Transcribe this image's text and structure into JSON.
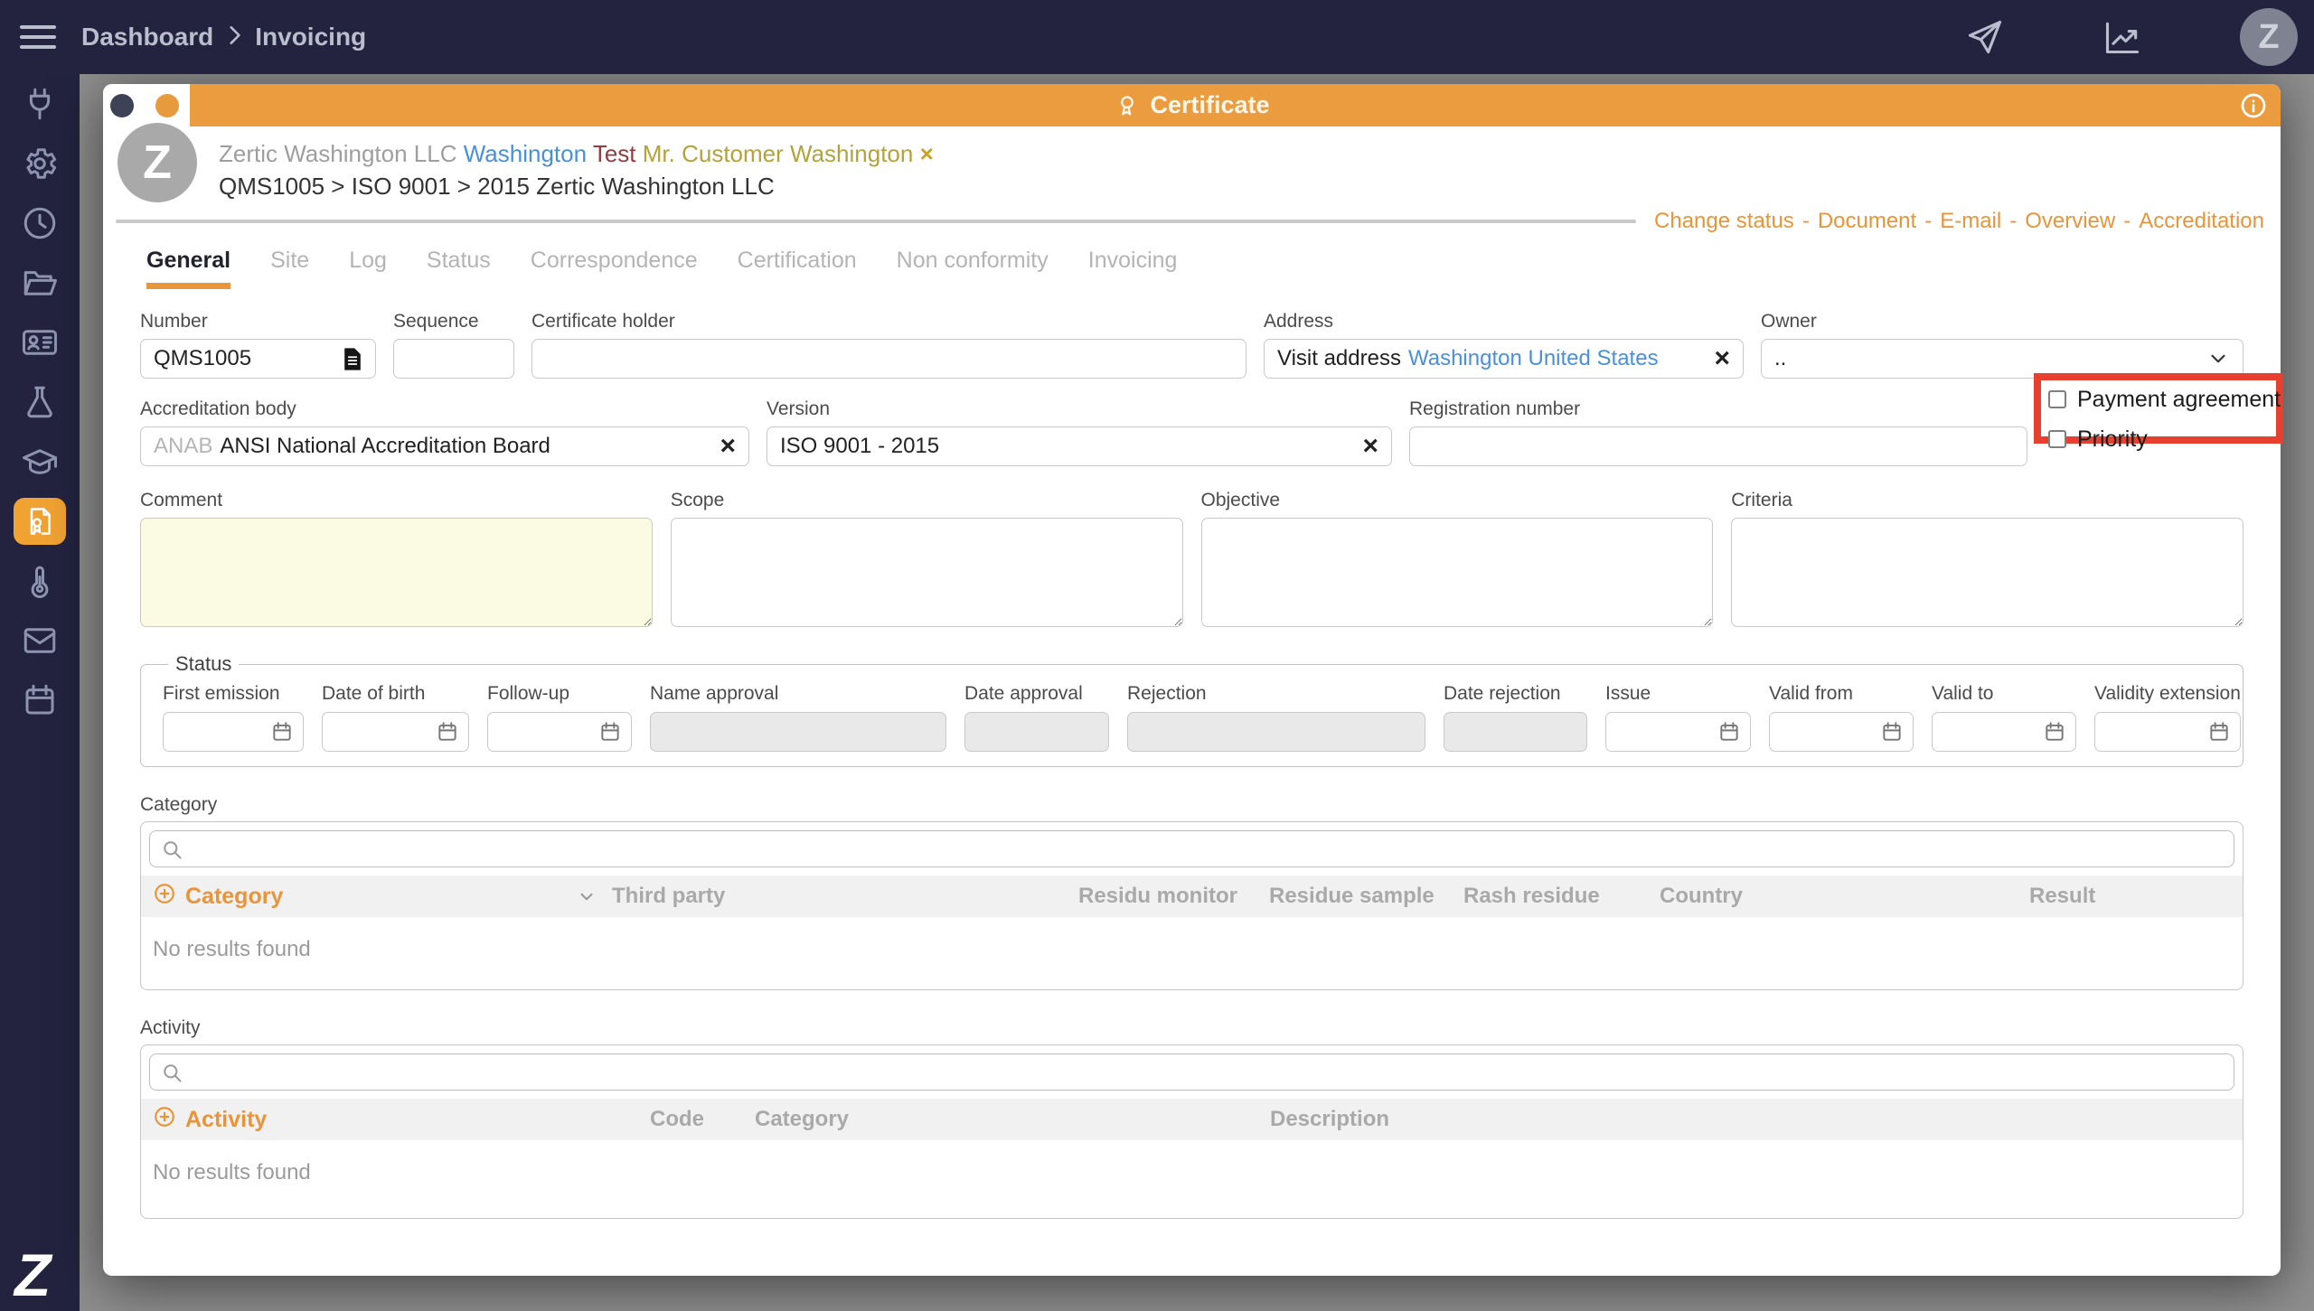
{
  "colors": {
    "navy": "#232340",
    "accent_orange": "#eb9c3e",
    "link_orange": "#e8953a",
    "annotation_red": "#e8402e",
    "comment_bg": "#fbfbe3"
  },
  "icons": {
    "clear": "×",
    "remove": "×"
  },
  "topbar": {
    "breadcrumb": [
      "Dashboard",
      "Invoicing"
    ],
    "avatar_initial": "Z"
  },
  "sidebar": {
    "logo_text": "Z",
    "items": [
      {
        "icon": "plug-icon"
      },
      {
        "icon": "gear-icon"
      },
      {
        "icon": "clock-icon"
      },
      {
        "icon": "folder-icon"
      },
      {
        "icon": "id-card-icon"
      },
      {
        "icon": "flask-icon"
      },
      {
        "icon": "graduation-cap-icon"
      },
      {
        "icon": "certificate-icon",
        "active": true
      },
      {
        "icon": "thermometer-icon"
      },
      {
        "icon": "envelope-icon"
      },
      {
        "icon": "calendar-icon"
      }
    ]
  },
  "modal": {
    "header": {
      "title": "Certificate"
    },
    "entity": {
      "avatar_initial": "Z",
      "company": "Zertic Washington LLC",
      "location": "Washington",
      "type": "Test",
      "contact": "Mr. Customer Washington",
      "path": "QMS1005 > ISO 9001 > 2015 Zertic Washington LLC"
    },
    "quick_links": [
      "Change status",
      "Document",
      "E-mail",
      "Overview",
      "Accreditation"
    ],
    "quick_links_separator": "-",
    "tabs": [
      "General",
      "Site",
      "Log",
      "Status",
      "Correspondence",
      "Certification",
      "Non conformity",
      "Invoicing"
    ],
    "active_tab": "General",
    "form": {
      "number": {
        "label": "Number",
        "value": "QMS1005"
      },
      "sequence": {
        "label": "Sequence",
        "value": ""
      },
      "certificate_holder": {
        "label": "Certificate holder",
        "value": ""
      },
      "address": {
        "label": "Address",
        "prefix": "Visit address",
        "value": "Washington United States"
      },
      "owner": {
        "label": "Owner",
        "value": ".."
      },
      "accreditation_body": {
        "label": "Accreditation body",
        "prefix": "ANAB",
        "value": "ANSI National Accreditation Board"
      },
      "version": {
        "label": "Version",
        "value": "ISO 9001 - 2015"
      },
      "registration_number": {
        "label": "Registration number",
        "value": ""
      },
      "payment_agreement": {
        "label": "Payment agreement",
        "checked": false
      },
      "priority": {
        "label": "Priority",
        "checked": false
      },
      "comment": {
        "label": "Comment",
        "value": ""
      },
      "scope": {
        "label": "Scope",
        "value": ""
      },
      "objective": {
        "label": "Objective",
        "value": ""
      },
      "criteria": {
        "label": "Criteria",
        "value": ""
      }
    },
    "status_fieldset": {
      "legend": "Status",
      "fields": [
        {
          "label": "First emission",
          "type": "date"
        },
        {
          "label": "Date of birth",
          "type": "date"
        },
        {
          "label": "Follow-up",
          "type": "date"
        },
        {
          "label": "Name approval",
          "type": "disabled"
        },
        {
          "label": "Date approval",
          "type": "disabled"
        },
        {
          "label": "Rejection",
          "type": "disabled"
        },
        {
          "label": "Date rejection",
          "type": "disabled"
        },
        {
          "label": "Issue",
          "type": "date"
        },
        {
          "label": "Valid from",
          "type": "date"
        },
        {
          "label": "Valid to",
          "type": "date"
        },
        {
          "label": "Validity extension",
          "type": "date"
        }
      ]
    },
    "category_section": {
      "label": "Category",
      "add_label": "Category",
      "columns": [
        "Third party",
        "Residu monitor",
        "Residue sample",
        "Rash residue",
        "Country",
        "Result"
      ],
      "empty_text": "No results found"
    },
    "activity_section": {
      "label": "Activity",
      "add_label": "Activity",
      "columns": [
        "Code",
        "Category",
        "Description"
      ],
      "empty_text": "No results found"
    }
  },
  "annotation": {
    "target": "Payment agreement",
    "color": "#e8402e"
  }
}
